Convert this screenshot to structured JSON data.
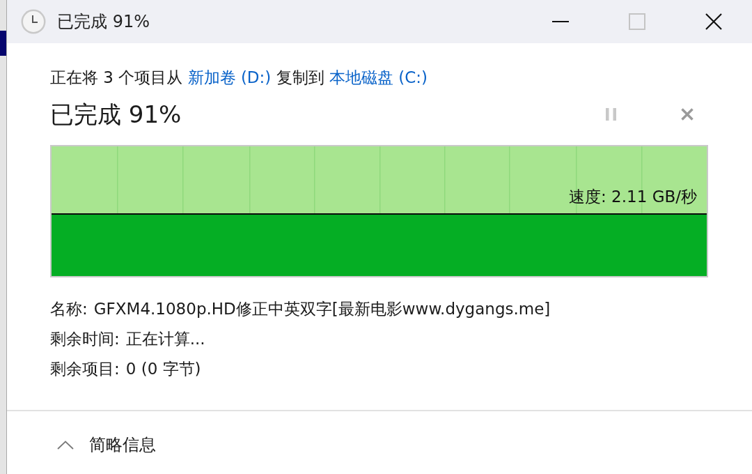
{
  "window": {
    "title": "已完成 91%",
    "controls": [
      {
        "kind": "minimize",
        "disabled": false
      },
      {
        "kind": "maximize",
        "disabled": true
      },
      {
        "kind": "close",
        "disabled": false
      }
    ]
  },
  "copy": {
    "message": [
      {
        "kind": "text",
        "text": "正在将 3 个项目从"
      },
      {
        "kind": "link",
        "text": "新加卷 (D:)"
      },
      {
        "kind": "text",
        "text": "复制到"
      },
      {
        "kind": "link",
        "text": "本地磁盘 (C:)"
      }
    ],
    "progress_title": "已完成 91%",
    "speed": "速度: 2.11 GB/秒"
  },
  "details": [
    {
      "label": "名称:",
      "value": "GFXM4.1080p.HD修正中英双字[最新电影www.dygangs.me]"
    },
    {
      "label": "剩余时间:",
      "value": "正在计算..."
    },
    {
      "label": "剩余项目:",
      "value": "0 (0 字节)"
    }
  ],
  "footer": {
    "toggle": "简略信息"
  }
}
